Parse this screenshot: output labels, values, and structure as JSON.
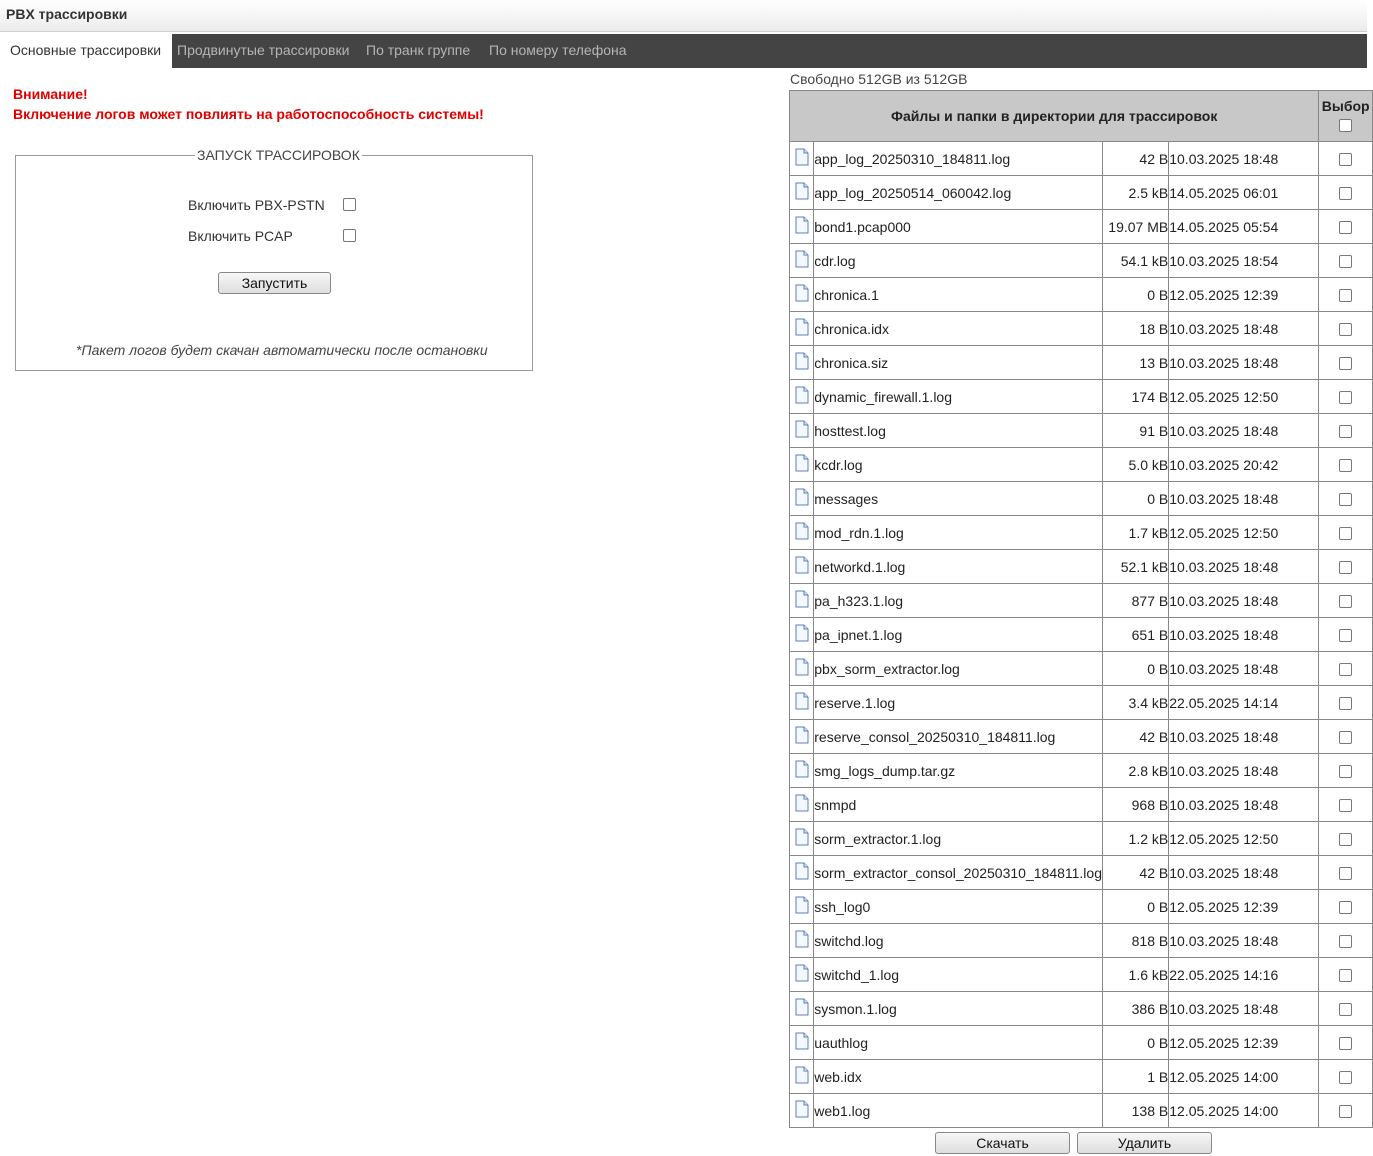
{
  "window": {
    "title": "PBX трассировки"
  },
  "tabs": [
    {
      "label": "Основные трассировки",
      "active": true
    },
    {
      "label": "Продвинутые трассировки",
      "active": false
    },
    {
      "label": "По транк группе",
      "active": false
    },
    {
      "label": "По номеру телефона",
      "active": false
    }
  ],
  "warning": {
    "line1": "Внимание!",
    "line2": "Включение логов может повлиять на работоспособность системы!"
  },
  "trace_panel": {
    "legend": "ЗАПУСК ТРАССИРОВОК",
    "options": [
      {
        "label": "Включить PBX-PSTN",
        "checked": false
      },
      {
        "label": "Включить PCAP",
        "checked": false
      }
    ],
    "start_button": "Запустить",
    "note": "*Пакет логов будет скачан автоматически после остановки"
  },
  "storage": {
    "free_text": "Свободно 512GB из 512GB"
  },
  "files_table": {
    "header_title": "Файлы и папки в директории для трассировок",
    "header_select": "Выбор",
    "rows": [
      {
        "icon": "file-icon",
        "name": "app_log_20250310_184811.log",
        "size": "42 B",
        "date": "10.03.2025 18:48"
      },
      {
        "icon": "file-icon",
        "name": "app_log_20250514_060042.log",
        "size": "2.5 kB",
        "date": "14.05.2025 06:01"
      },
      {
        "icon": "file-icon",
        "name": "bond1.pcap000",
        "size": "19.07 MB",
        "date": "14.05.2025 05:54"
      },
      {
        "icon": "file-icon",
        "name": "cdr.log",
        "size": "54.1 kB",
        "date": "10.03.2025 18:54"
      },
      {
        "icon": "file-icon",
        "name": "chronica.1",
        "size": "0 B",
        "date": "12.05.2025 12:39"
      },
      {
        "icon": "file-icon",
        "name": "chronica.idx",
        "size": "18 B",
        "date": "10.03.2025 18:48"
      },
      {
        "icon": "file-icon",
        "name": "chronica.siz",
        "size": "13 B",
        "date": "10.03.2025 18:48"
      },
      {
        "icon": "file-icon",
        "name": "dynamic_firewall.1.log",
        "size": "174 B",
        "date": "12.05.2025 12:50"
      },
      {
        "icon": "file-icon",
        "name": "hosttest.log",
        "size": "91 B",
        "date": "10.03.2025 18:48"
      },
      {
        "icon": "file-icon",
        "name": "kcdr.log",
        "size": "5.0 kB",
        "date": "10.03.2025 20:42"
      },
      {
        "icon": "file-icon",
        "name": "messages",
        "size": "0 B",
        "date": "10.03.2025 18:48"
      },
      {
        "icon": "file-icon",
        "name": "mod_rdn.1.log",
        "size": "1.7 kB",
        "date": "12.05.2025 12:50"
      },
      {
        "icon": "file-icon",
        "name": "networkd.1.log",
        "size": "52.1 kB",
        "date": "10.03.2025 18:48"
      },
      {
        "icon": "file-icon",
        "name": "pa_h323.1.log",
        "size": "877 B",
        "date": "10.03.2025 18:48"
      },
      {
        "icon": "file-icon",
        "name": "pa_ipnet.1.log",
        "size": "651 B",
        "date": "10.03.2025 18:48"
      },
      {
        "icon": "file-icon",
        "name": "pbx_sorm_extractor.log",
        "size": "0 B",
        "date": "10.03.2025 18:48"
      },
      {
        "icon": "file-icon",
        "name": "reserve.1.log",
        "size": "3.4 kB",
        "date": "22.05.2025 14:14"
      },
      {
        "icon": "file-icon",
        "name": "reserve_consol_20250310_184811.log",
        "size": "42 B",
        "date": "10.03.2025 18:48"
      },
      {
        "icon": "file-icon",
        "name": "smg_logs_dump.tar.gz",
        "size": "2.8 kB",
        "date": "10.03.2025 18:48"
      },
      {
        "icon": "file-icon",
        "name": "snmpd",
        "size": "968 B",
        "date": "10.03.2025 18:48"
      },
      {
        "icon": "file-icon",
        "name": "sorm_extractor.1.log",
        "size": "1.2 kB",
        "date": "12.05.2025 12:50"
      },
      {
        "icon": "file-icon",
        "name": "sorm_extractor_consol_20250310_184811.log",
        "size": "42 B",
        "date": "10.03.2025 18:48"
      },
      {
        "icon": "file-icon",
        "name": "ssh_log0",
        "size": "0 B",
        "date": "12.05.2025 12:39"
      },
      {
        "icon": "file-icon",
        "name": "switchd.log",
        "size": "818 B",
        "date": "10.03.2025 18:48"
      },
      {
        "icon": "file-icon",
        "name": "switchd_1.log",
        "size": "1.6 kB",
        "date": "22.05.2025 14:16"
      },
      {
        "icon": "file-icon",
        "name": "sysmon.1.log",
        "size": "386 B",
        "date": "10.03.2025 18:48"
      },
      {
        "icon": "file-icon",
        "name": "uauthlog",
        "size": "0 B",
        "date": "12.05.2025 12:39"
      },
      {
        "icon": "file-icon",
        "name": "web.idx",
        "size": "1 B",
        "date": "12.05.2025 14:00"
      },
      {
        "icon": "file-icon",
        "name": "web1.log",
        "size": "138 B",
        "date": "12.05.2025 14:00"
      }
    ]
  },
  "actions": {
    "download": "Скачать",
    "delete": "Удалить"
  },
  "colors": {
    "tabbar": "#444444",
    "warning": "#e00000",
    "table_header": "#c8c8c8"
  }
}
